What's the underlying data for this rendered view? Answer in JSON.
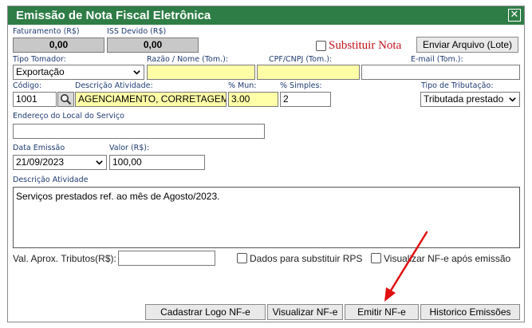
{
  "window": {
    "title": "Emissão de Nota Fiscal Eletrônica",
    "close_glyph": "✕"
  },
  "faturamento": {
    "label": "Faturamento (R$)",
    "value": "0,00"
  },
  "iss": {
    "label": "ISS Devido (R$)",
    "value": "0,00"
  },
  "substituir_nota": {
    "label": "Substituir Nota",
    "checked": false,
    "color": "#c0141c"
  },
  "enviar_lote": {
    "label": "Enviar Arquivo (Lote)"
  },
  "tomador": {
    "tipo_label": "Tipo Tomador:",
    "tipo_value": "Exportação",
    "razao_label": "Razão / Nome (Tom.):",
    "razao_value": "",
    "cpf_label": "CPF/CNPJ (Tom.):",
    "cpf_value": "",
    "email_label": "E-mail (Tom.):",
    "email_value": ""
  },
  "atividade": {
    "codigo_label": "Código:",
    "codigo_value": "1001",
    "descricao_label": "Descrição Atividade:",
    "descricao_value": "AGENCIAMENTO, CORRETAGEM",
    "mun_label": "% Mun:",
    "mun_value": "3.00",
    "simples_label": "% Simples:",
    "simples_value": "2",
    "tributacao_label": "Tipo de Tributação:",
    "tributacao_value": "Tributada prestado"
  },
  "endereco": {
    "label": "Endereço do Local do Serviço",
    "value": ""
  },
  "data_emissao": {
    "label": "Data Emissão",
    "value": "21/09/2023"
  },
  "valor": {
    "label": "Valor (R$):",
    "value": "100,00"
  },
  "descricao": {
    "label": "Descrição Atividade",
    "value": "Serviços prestados ref. ao mês de Agosto/2023."
  },
  "tributos": {
    "label": "Val. Aprox. Tributos(R$):",
    "value": ""
  },
  "dados_rps": {
    "label": "Dados para substituir RPS",
    "checked": false
  },
  "visualizar_apos": {
    "label": "Visualizar NF-e após emissão",
    "checked": false
  },
  "buttons": {
    "cadastrar_logo": "Cadastrar Logo NF-e",
    "visualizar": "Visualizar NF-e",
    "emitir": "Emitir NF-e",
    "historico": "Historico Emissões"
  },
  "colors": {
    "titlebar": "#2e7d46",
    "required_field": "#ffffa8",
    "annotation_arrow": "#e01010"
  },
  "icons": {
    "search": "magnifier-icon",
    "dropdown": "chevron-down-icon",
    "close": "close-icon"
  }
}
